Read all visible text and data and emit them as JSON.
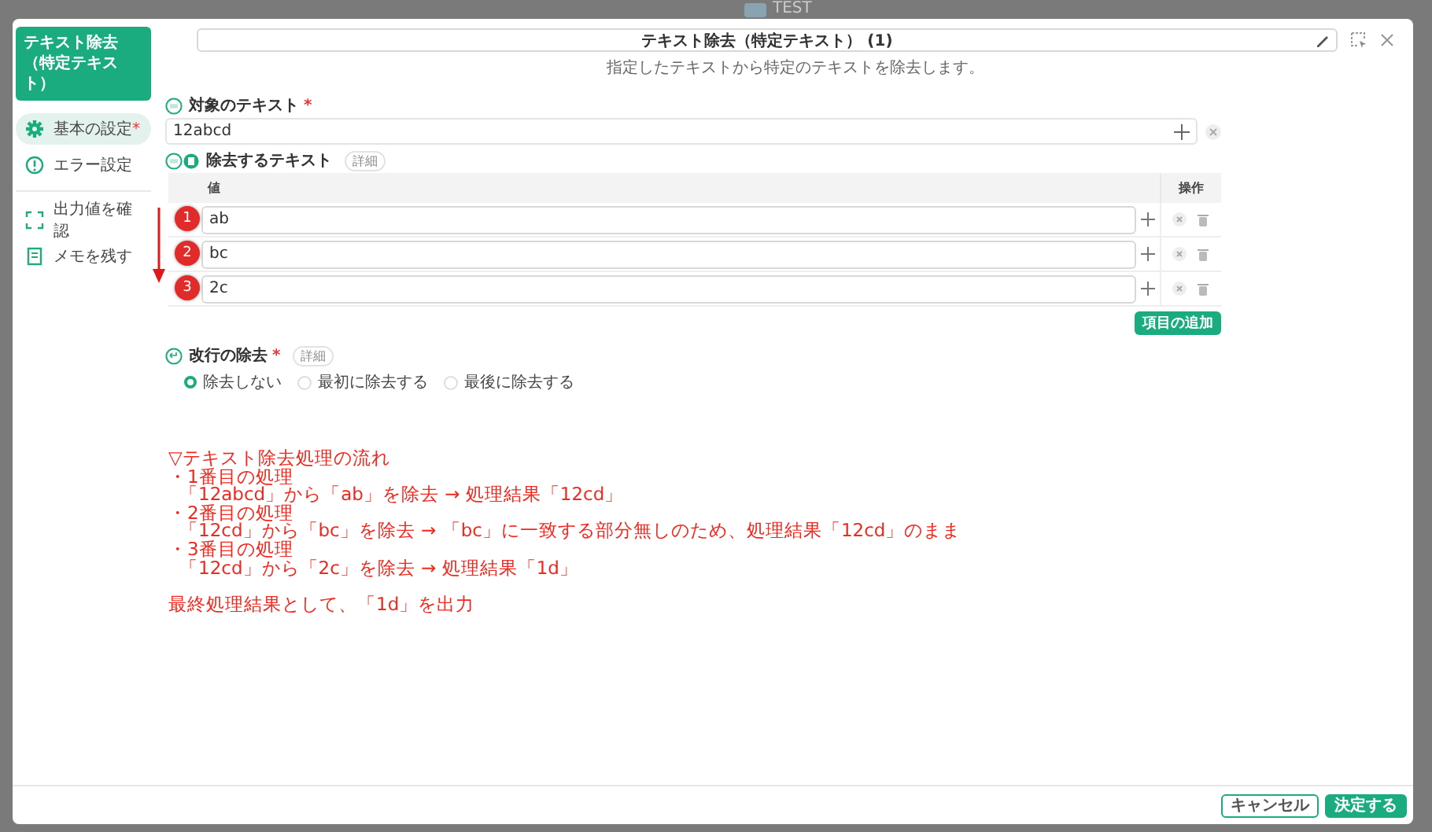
{
  "background_app": {
    "title": "TEST"
  },
  "dialog": {
    "badge_title": "テキスト除去（特定テキスト）",
    "title": "テキスト除去（特定テキスト） (1)",
    "subtitle": "指定したテキストから特定のテキストを除去します。"
  },
  "sidebar": {
    "groups": [
      [
        {
          "label": "基本の設定",
          "mark": "*",
          "selected": true
        },
        {
          "label": "エラー設定",
          "selected": false
        }
      ],
      [
        {
          "label": "出力値を確認",
          "selected": false
        },
        {
          "label": "メモを残す",
          "selected": false
        }
      ]
    ]
  },
  "target_text": {
    "label": "対象のテキスト",
    "mark": "*",
    "value": "12abcd"
  },
  "remove_text": {
    "label": "除去するテキスト",
    "detail": "詳細",
    "columns": [
      "値",
      "操作"
    ],
    "rows": [
      {
        "number": "1",
        "value": "ab"
      },
      {
        "number": "2",
        "value": "bc"
      },
      {
        "number": "3",
        "value": "2c"
      }
    ],
    "add_button": "項目の追加"
  },
  "newline_removal": {
    "label": "改行の除去",
    "mark": "*",
    "detail": "詳細",
    "options": [
      {
        "label": "除去しない",
        "selected": true
      },
      {
        "label": "最初に除去する",
        "selected": false
      },
      {
        "label": "最後に除去する",
        "selected": false
      }
    ]
  },
  "note": [
    {
      "kind": "heading",
      "text": "▽テキスト除去処理の流れ"
    },
    {
      "kind": "step",
      "text": "・1番目の処理"
    },
    {
      "kind": "detail",
      "text": "「12abcd」から「ab」を除去 → 処理結果「12cd」"
    },
    {
      "kind": "step",
      "text": "・2番目の処理"
    },
    {
      "kind": "detail",
      "text": "「12cd」から「bc」を除去 → 「bc」に一致する部分無しのため、処理結果「12cd」のまま"
    },
    {
      "kind": "step",
      "text": "・3番目の処理"
    },
    {
      "kind": "detail",
      "text": "「12cd」から「2c」を除去 → 処理結果「1d」"
    },
    {
      "kind": "conclusion",
      "text": "最終処理結果として、「1d」を出力"
    }
  ],
  "footer": {
    "cancel": "キャンセル",
    "confirm": "決定する"
  }
}
